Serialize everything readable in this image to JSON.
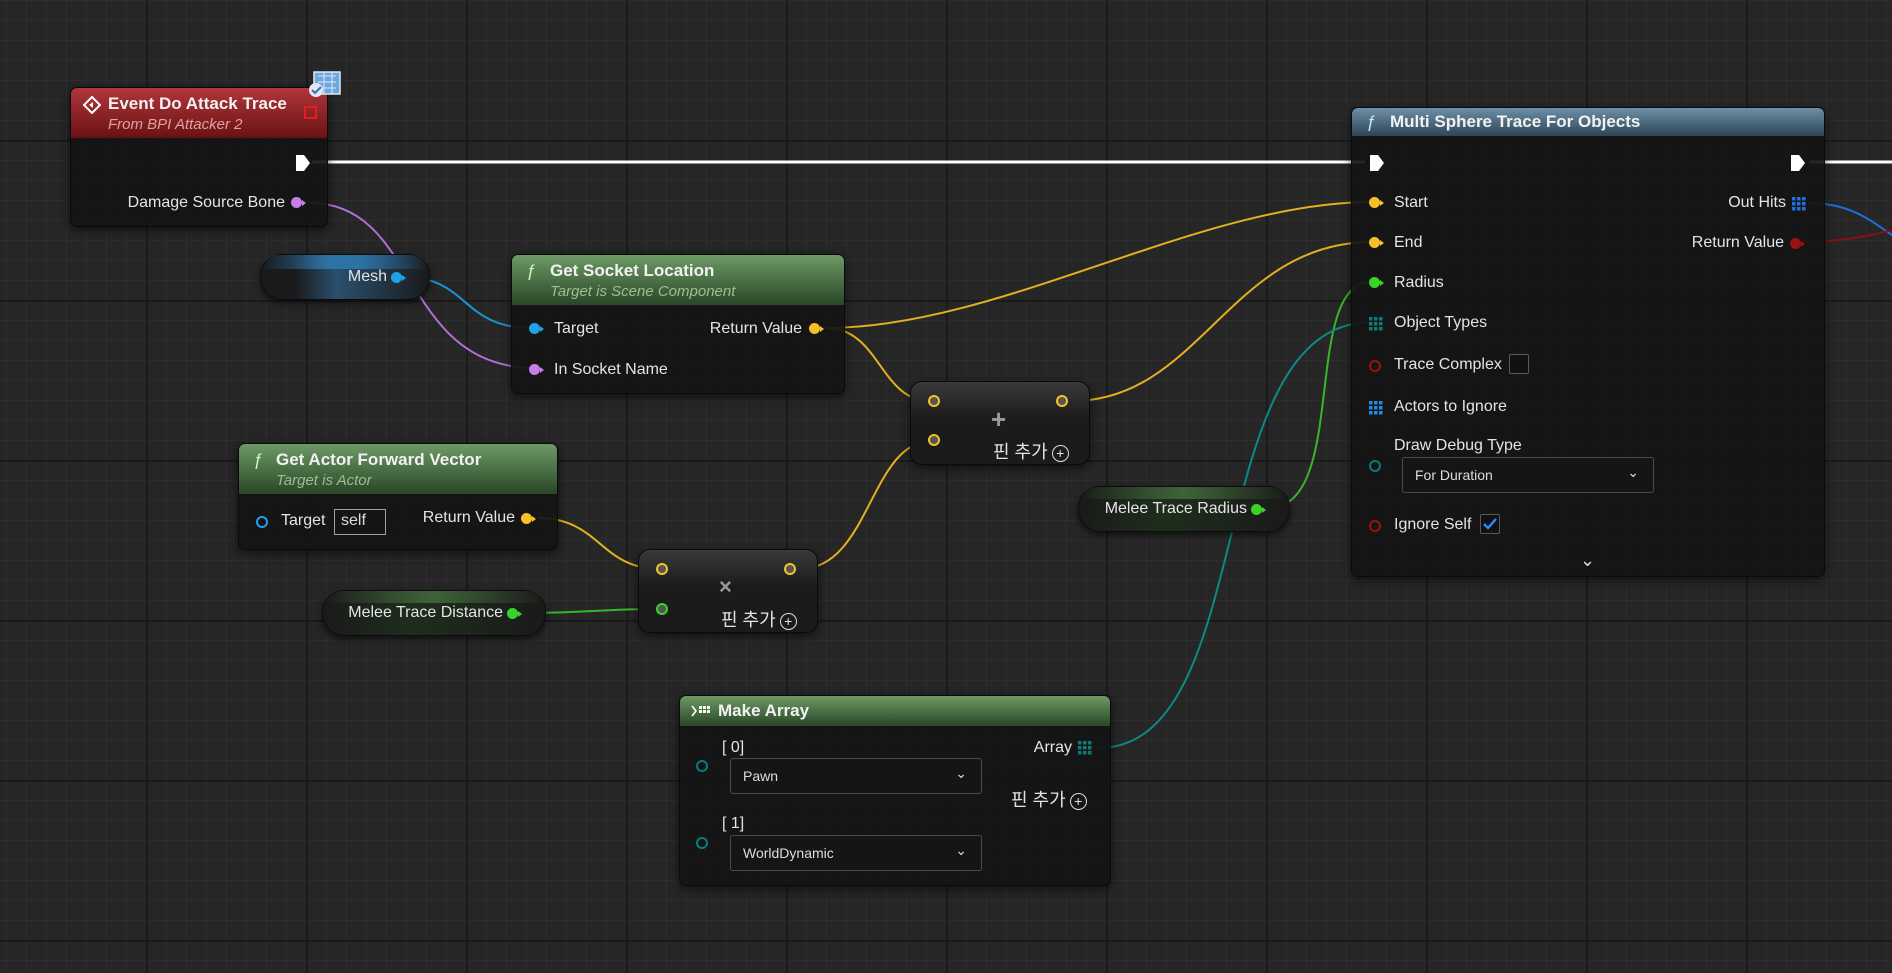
{
  "event_node": {
    "title": "Event Do Attack Trace",
    "subtitle": "From BPI Attacker 2",
    "pin_damage_source_bone": "Damage Source Bone"
  },
  "mesh_var": {
    "label": "Mesh"
  },
  "get_socket_location": {
    "title": "Get Socket Location",
    "subtitle": "Target is Scene Component",
    "pin_target": "Target",
    "pin_in_socket_name": "In Socket Name",
    "pin_return_value": "Return Value"
  },
  "get_actor_forward_vector": {
    "title": "Get Actor Forward Vector",
    "subtitle": "Target is Actor",
    "pin_target": "Target",
    "target_value": "self",
    "pin_return_value": "Return Value"
  },
  "melee_trace_distance_var": {
    "label": "Melee Trace Distance"
  },
  "multiply_node": {
    "symbol": "×",
    "add_pin_label": "핀 추가",
    "add_pin_icon": "+"
  },
  "add_node": {
    "symbol": "+",
    "add_pin_label": "핀 추가",
    "add_pin_icon": "+"
  },
  "melee_trace_radius_var": {
    "label": "Melee Trace Radius"
  },
  "make_array": {
    "title": "Make Array",
    "pin_0": "[ 0]",
    "pin_0_value": "Pawn",
    "pin_1": "[ 1]",
    "pin_1_value": "WorldDynamic",
    "pin_array": "Array",
    "add_pin_label": "핀 추가",
    "add_pin_icon": "+"
  },
  "multi_sphere_trace": {
    "title": "Multi Sphere Trace For Objects",
    "pin_start": "Start",
    "pin_end": "End",
    "pin_radius": "Radius",
    "pin_object_types": "Object Types",
    "pin_trace_complex": "Trace Complex",
    "pin_actors_to_ignore": "Actors to Ignore",
    "pin_draw_debug_type": "Draw Debug Type",
    "draw_debug_type_value": "For Duration",
    "pin_ignore_self": "Ignore Self",
    "pin_out_hits": "Out Hits",
    "pin_return_value": "Return Value"
  },
  "colors": {
    "exec": "#ffffff",
    "vector": "#f5c02a",
    "object": "#1fa2e8",
    "name": "#c77ee8",
    "float": "#3ad32a",
    "bool": "#9b1111",
    "array": "#0b7c7a",
    "struct_array": "#1e6fe0"
  },
  "icons": {
    "event": "event-diamond-icon",
    "function": "function-f-icon",
    "array": "array-grid-icon",
    "chevron": "chevron-down-icon",
    "check": "checkmark-icon"
  }
}
